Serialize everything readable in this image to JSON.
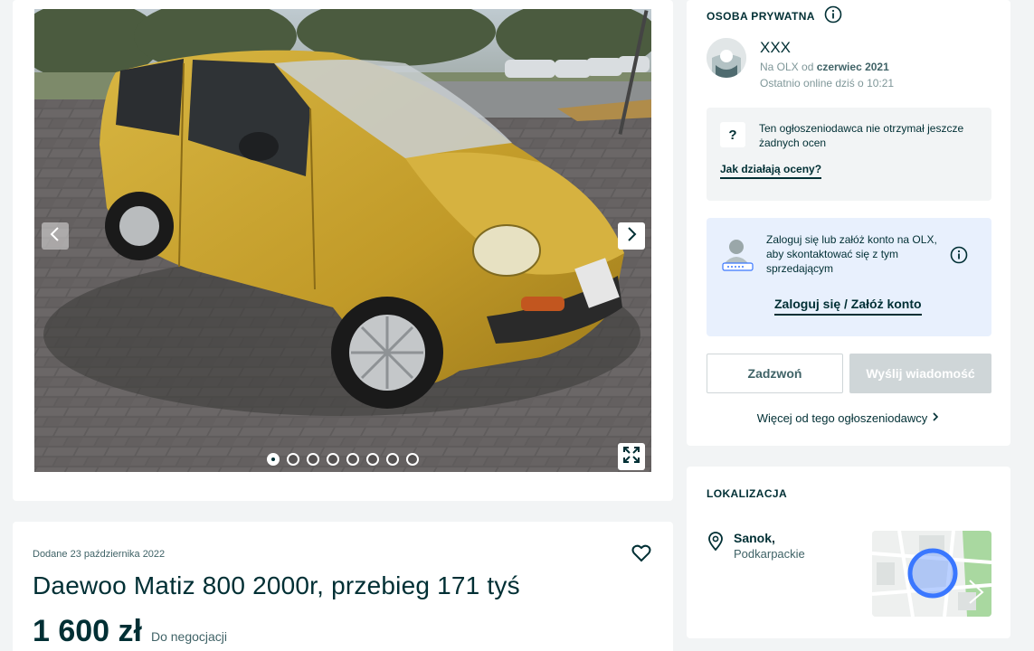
{
  "gallery": {
    "total_images": 8,
    "active_index": 1,
    "icons": {
      "prev": "chevron-left-icon",
      "next": "chevron-right-icon",
      "fullscreen": "expand-icon"
    }
  },
  "ad": {
    "added_date": "Dodane 23 października 2022",
    "title": "Daewoo Matiz 800 2000r, przebieg 171 tyś",
    "price": "1 600 zł",
    "price_note": "Do negocjacji"
  },
  "seller": {
    "type_label": "OSOBA PRYWATNA",
    "name": "XXX",
    "member_prefix": "Na OLX od ",
    "member_since": "czerwiec 2021",
    "last_online": "Ostatnio online dziś o 10:21",
    "ratings_text": "Ten ogłoszeniodawca nie otrzymał jeszcze żadnych ocen",
    "ratings_link": "Jak działają oceny?",
    "login_text": "Zaloguj się lub załóż konto na OLX, aby skontaktować się z tym sprzedającym",
    "login_link": "Zaloguj się / Załóż konto",
    "call_button": "Zadzwoń",
    "message_button": "Wyślij wiadomość",
    "more_link": "Więcej od tego ogłoszeniodawcy"
  },
  "location": {
    "heading": "LOKALIZACJA",
    "city": "Sanok,",
    "region": "Podkarpackie"
  },
  "colors": {
    "text_primary": "#002f34",
    "background": "#f2f4f5",
    "login_box": "#e8f0fd",
    "map_marker": "#3a77ff",
    "car": "#c9a232"
  }
}
